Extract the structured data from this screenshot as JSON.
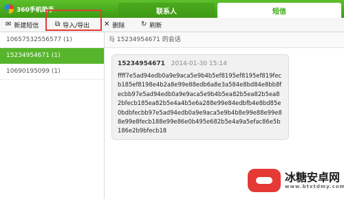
{
  "app": {
    "title": "360手机助手"
  },
  "tabs": [
    {
      "label": "联系人",
      "active": false
    },
    {
      "label": "短信",
      "active": true
    }
  ],
  "toolbar": {
    "new_label": "新建短信",
    "import_export_label": "导入/导出",
    "delete_label": "删除",
    "refresh_label": "刷新"
  },
  "conversations": [
    {
      "label": "10657532556577 (1)",
      "active": false
    },
    {
      "label": "15234954671 (1)",
      "active": true
    },
    {
      "label": "10690195099 (1)",
      "active": false
    }
  ],
  "chat": {
    "header": "与 15234954671 的会话",
    "message": {
      "sender": "15234954671",
      "time": "2014-01-30 15:14",
      "body": "ffff7e5ad94edb0a9e9aca5e9b4b5ef8195ef8195ef819fecb185ef8198e4b2a8e99e88edb6a8e3a584e8bd84e8bb8fecbb97e5ad94edb0a9e9aca5e9b4b5ea82b5ea82b5ea82bfecb185ea82b5e4a4b5e6a288e99e84edbfb4e8bd85e0bdbfecbb97e5ad94edb0a9e9aca5e9b4b8e99e88e99e88e99e8fecb188e99e86e0b495e682b5e4a9a5efac86e5b186e2b9bfecb18"
    }
  },
  "watermark": {
    "text": "冰糖安卓网",
    "url": "www.btxtdmy.com"
  },
  "colors": {
    "brand_green": "#3d9c14",
    "active_green": "#57b52c",
    "highlight_red": "#e53935"
  }
}
